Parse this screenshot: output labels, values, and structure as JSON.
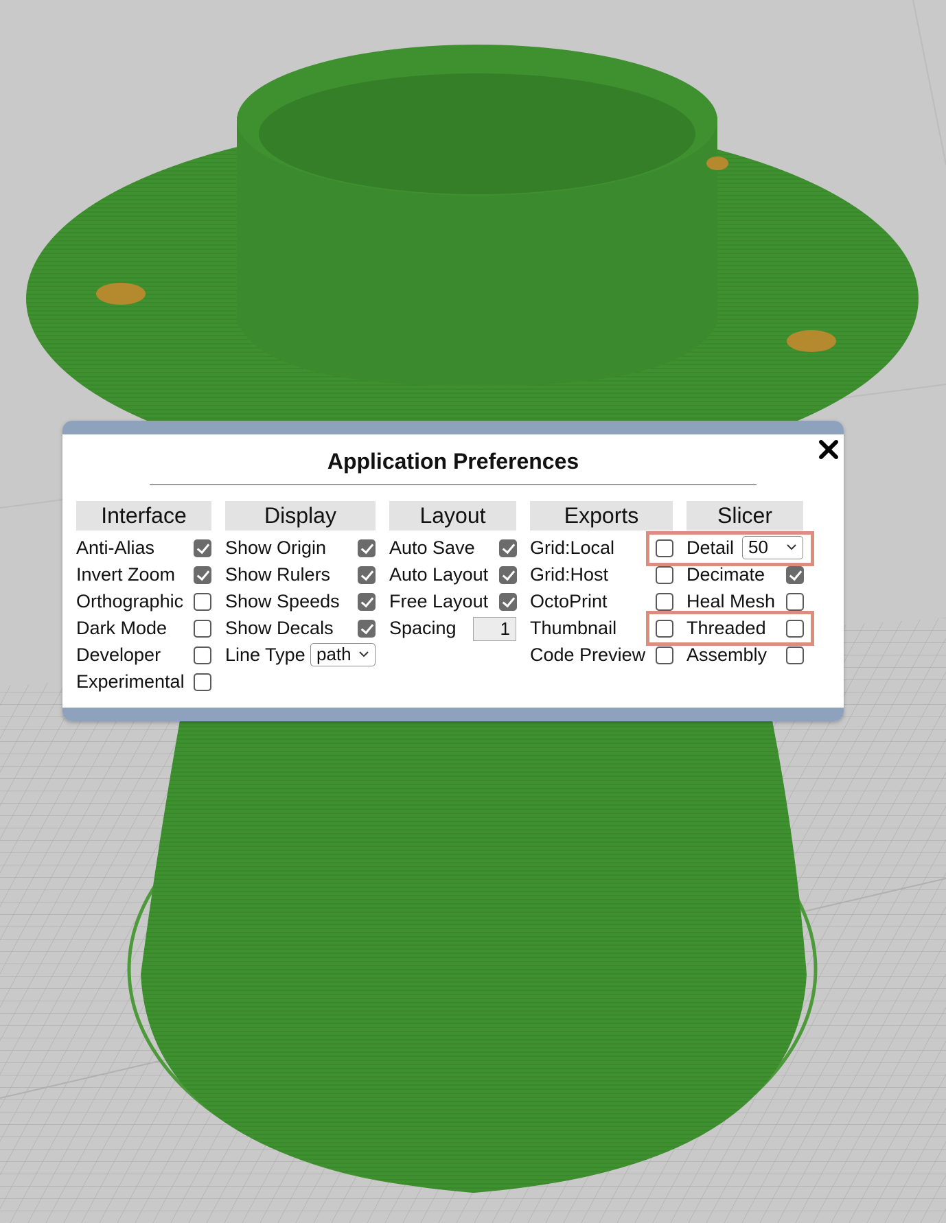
{
  "dialog": {
    "title": "Application Preferences",
    "close_icon": "close-x-icon"
  },
  "columns": {
    "interface": {
      "header": "Interface",
      "items": [
        {
          "label": "Anti-Alias",
          "checked": true
        },
        {
          "label": "Invert Zoom",
          "checked": true
        },
        {
          "label": "Orthographic",
          "checked": false
        },
        {
          "label": "Dark Mode",
          "checked": false
        },
        {
          "label": "Developer",
          "checked": false
        },
        {
          "label": "Experimental",
          "checked": false
        }
      ]
    },
    "display": {
      "header": "Display",
      "items": [
        {
          "label": "Show Origin",
          "checked": true
        },
        {
          "label": "Show Rulers",
          "checked": true
        },
        {
          "label": "Show Speeds",
          "checked": true
        },
        {
          "label": "Show Decals",
          "checked": true
        }
      ],
      "line_type": {
        "label": "Line Type",
        "value": "path"
      }
    },
    "layout": {
      "header": "Layout",
      "items": [
        {
          "label": "Auto Save",
          "checked": true
        },
        {
          "label": "Auto Layout",
          "checked": true
        },
        {
          "label": "Free Layout",
          "checked": true
        }
      ],
      "spacing": {
        "label": "Spacing",
        "value": "1"
      }
    },
    "exports": {
      "header": "Exports",
      "items": [
        {
          "label": "Grid:Local",
          "checked": false
        },
        {
          "label": "Grid:Host",
          "checked": false
        },
        {
          "label": "OctoPrint",
          "checked": false
        },
        {
          "label": "Thumbnail",
          "checked": false
        },
        {
          "label": "Code Preview",
          "checked": false
        }
      ]
    },
    "slicer": {
      "header": "Slicer",
      "detail": {
        "label": "Detail",
        "value": "50"
      },
      "items": [
        {
          "label": "Decimate",
          "checked": true
        },
        {
          "label": "Heal Mesh",
          "checked": false
        },
        {
          "label": "Threaded",
          "checked": false
        },
        {
          "label": "Assembly",
          "checked": false
        }
      ]
    }
  },
  "colors": {
    "model_green": "#3f9130",
    "dialog_bar": "#8ea2bd",
    "highlight": "#d98e7e",
    "grid_bg": "#c9c9c9"
  }
}
